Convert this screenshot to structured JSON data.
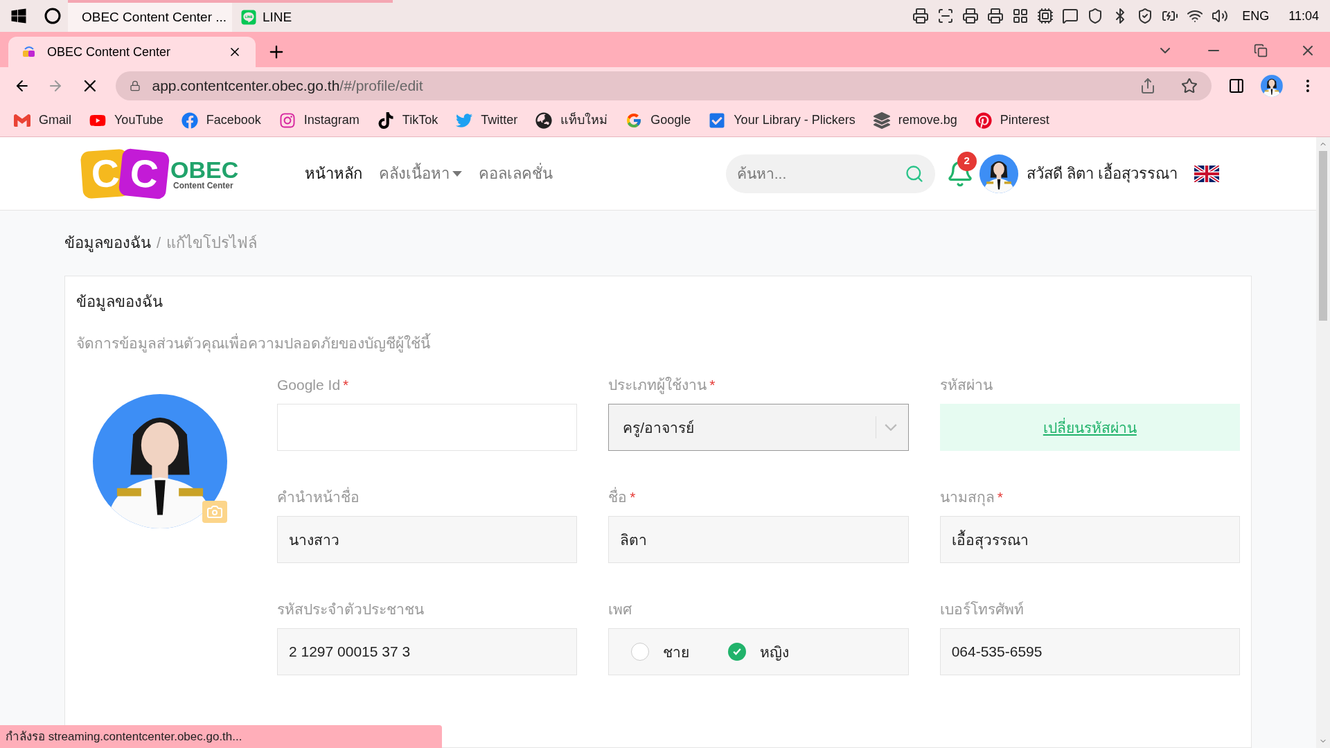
{
  "taskbar": {
    "apps": [
      {
        "label": "OBEC Content Center ...",
        "kind": "chrome",
        "selected": true
      },
      {
        "label": "LINE",
        "kind": "line",
        "selected": false
      }
    ],
    "language": "ENG",
    "time": "11:04"
  },
  "browser": {
    "tabs": [
      {
        "title": "OBEC Content Center",
        "selected": true
      }
    ],
    "url_host": "app.contentcenter.obec.go.th",
    "url_path": "/#/profile/edit",
    "bookmarks": [
      {
        "label": "Gmail",
        "kind": "gmail"
      },
      {
        "label": "YouTube",
        "kind": "youtube"
      },
      {
        "label": "Facebook",
        "kind": "facebook"
      },
      {
        "label": "Instagram",
        "kind": "instagram"
      },
      {
        "label": "TikTok",
        "kind": "tiktok"
      },
      {
        "label": "Twitter",
        "kind": "twitter"
      },
      {
        "label": "แท็บใหม่",
        "kind": "globe"
      },
      {
        "label": "Google",
        "kind": "google"
      },
      {
        "label": "Your Library - Plickers",
        "kind": "check"
      },
      {
        "label": "remove.bg",
        "kind": "layers"
      },
      {
        "label": "Pinterest",
        "kind": "pinterest"
      }
    ]
  },
  "site": {
    "logo": {
      "letters": [
        "C",
        "C"
      ],
      "name": "OBEC",
      "tagline": "Content Center"
    },
    "nav": [
      {
        "label": "หน้าหลัก",
        "selected": true,
        "dropdown": false
      },
      {
        "label": "คลังเนื้อหา",
        "selected": false,
        "dropdown": true
      },
      {
        "label": "คอลเลคชั่น",
        "selected": false,
        "dropdown": false
      }
    ],
    "search": {
      "placeholder": "ค้นหา..."
    },
    "notifications": {
      "count": "2"
    },
    "greeting": "สวัสดี ลิตา เอื้อสุวรรณา"
  },
  "breadcrumb": {
    "items": [
      "ข้อมูลของฉัน",
      "แก้ไขโปรไฟล์"
    ],
    "separator": "/"
  },
  "card": {
    "title": "ข้อมูลของฉัน",
    "subtitle": "จัดการข้อมูลส่วนตัวคุณเพื่อความปลอดภัยของบัญชีผู้ใช้นี้",
    "fields": [
      {
        "label": "Google Id",
        "required_mark": "*",
        "kind": "text"
      },
      {
        "label": "ประเภทผู้ใช้งาน",
        "required_mark": "*",
        "kind": "select",
        "value": "ครู/อาจารย์"
      },
      {
        "label": "รหัสผ่าน",
        "kind": "link",
        "value": "เปลี่ยนรหัสผ่าน"
      },
      {
        "label": "คำนำหน้าชื่อ",
        "kind": "text",
        "value": "นางสาว"
      },
      {
        "label": "ชื่อ",
        "required_mark": "*",
        "kind": "text",
        "value": "ลิตา"
      },
      {
        "label": "นามสกุล",
        "required_mark": "*",
        "kind": "text",
        "value": "เอื้อสุวรรณา"
      },
      {
        "label": "รหัสประจำตัวประชาชน",
        "kind": "text",
        "value": "2 1297 00015 37 3"
      },
      {
        "label": "เพศ",
        "kind": "radio",
        "options": [
          {
            "label": "ชาย",
            "selected": false
          },
          {
            "label": "หญิง",
            "selected": true
          }
        ]
      },
      {
        "label": "เบอร์โทรศัพท์",
        "kind": "text",
        "value": "064-535-6595"
      }
    ]
  },
  "status_bar": "กำลังรอ streaming.contentcenter.obec.go.th..."
}
